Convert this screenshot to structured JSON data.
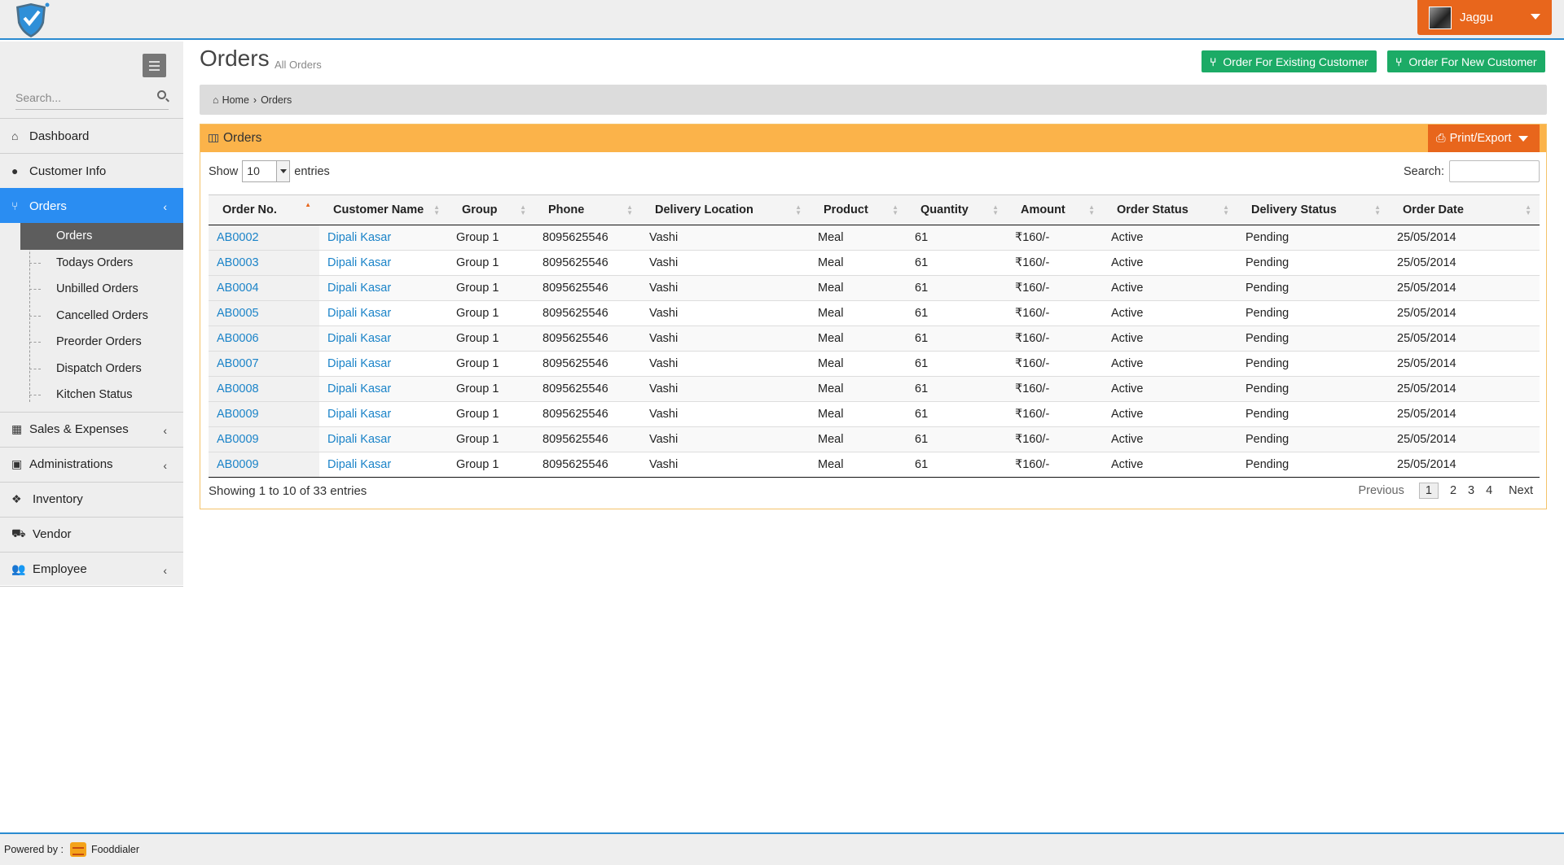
{
  "user": {
    "name": "Jaggu"
  },
  "sidebar": {
    "search_placeholder": "Search...",
    "items": [
      {
        "label": "Dashboard",
        "icon": "home-icon"
      },
      {
        "label": "Customer Info",
        "icon": "user-icon"
      },
      {
        "label": "Orders",
        "icon": "cutlery-icon",
        "active": true
      },
      {
        "label": "Sales & Expenses",
        "icon": "grid-icon"
      },
      {
        "label": "Administrations",
        "icon": "admin-icon"
      },
      {
        "label": "Inventory",
        "icon": "cubes-icon"
      },
      {
        "label": "Vendor",
        "icon": "truck-icon"
      },
      {
        "label": "Employee",
        "icon": "users-icon"
      }
    ],
    "orders_sub": [
      "Orders",
      "Todays Orders",
      "Unbilled Orders",
      "Cancelled Orders",
      "Preorder Orders",
      "Dispatch Orders",
      "Kitchen Status"
    ]
  },
  "page": {
    "title": "Orders",
    "subtitle": "All Orders",
    "btn_existing": "Order For Existing Customer",
    "btn_new": "Order For New Customer"
  },
  "breadcrumb": {
    "home": "Home",
    "current": "Orders"
  },
  "panel": {
    "title": "Orders",
    "print_label": "Print/Export",
    "show_label": "Show",
    "entries_label": "entries",
    "length_value": "10",
    "search_label": "Search:"
  },
  "table": {
    "columns": [
      "Order No.",
      "Customer Name",
      "Group",
      "Phone",
      "Delivery Location",
      "Product",
      "Quantity",
      "Amount",
      "Order Status",
      "Delivery Status",
      "Order Date"
    ],
    "rows": [
      [
        "AB0002",
        "Dipali Kasar",
        "Group 1",
        "8095625546",
        "Vashi",
        "Meal",
        "61",
        "₹160/-",
        "Active",
        "Pending",
        "25/05/2014"
      ],
      [
        "AB0003",
        "Dipali Kasar",
        "Group 1",
        "8095625546",
        "Vashi",
        "Meal",
        "61",
        "₹160/-",
        "Active",
        "Pending",
        "25/05/2014"
      ],
      [
        "AB0004",
        "Dipali Kasar",
        "Group 1",
        "8095625546",
        "Vashi",
        "Meal",
        "61",
        "₹160/-",
        "Active",
        "Pending",
        "25/05/2014"
      ],
      [
        "AB0005",
        "Dipali Kasar",
        "Group 1",
        "8095625546",
        "Vashi",
        "Meal",
        "61",
        "₹160/-",
        "Active",
        "Pending",
        "25/05/2014"
      ],
      [
        "AB0006",
        "Dipali Kasar",
        "Group 1",
        "8095625546",
        "Vashi",
        "Meal",
        "61",
        "₹160/-",
        "Active",
        "Pending",
        "25/05/2014"
      ],
      [
        "AB0007",
        "Dipali Kasar",
        "Group 1",
        "8095625546",
        "Vashi",
        "Meal",
        "61",
        "₹160/-",
        "Active",
        "Pending",
        "25/05/2014"
      ],
      [
        "AB0008",
        "Dipali Kasar",
        "Group 1",
        "8095625546",
        "Vashi",
        "Meal",
        "61",
        "₹160/-",
        "Active",
        "Pending",
        "25/05/2014"
      ],
      [
        "AB0009",
        "Dipali Kasar",
        "Group 1",
        "8095625546",
        "Vashi",
        "Meal",
        "61",
        "₹160/-",
        "Active",
        "Pending",
        "25/05/2014"
      ],
      [
        "AB0009",
        "Dipali Kasar",
        "Group 1",
        "8095625546",
        "Vashi",
        "Meal",
        "61",
        "₹160/-",
        "Active",
        "Pending",
        "25/05/2014"
      ],
      [
        "AB0009",
        "Dipali Kasar",
        "Group 1",
        "8095625546",
        "Vashi",
        "Meal",
        "61",
        "₹160/-",
        "Active",
        "Pending",
        "25/05/2014"
      ]
    ]
  },
  "pagination": {
    "info": "Showing 1 to 10 of 33 entries",
    "previous": "Previous",
    "pages": [
      "1",
      "2",
      "3",
      "4"
    ],
    "next": "Next"
  },
  "footer": {
    "powered_by": "Powered by :",
    "brand": "Fooddialer"
  },
  "colors": {
    "accent_blue": "#2a8df2",
    "orange": "#e8661c",
    "green": "#1cab66",
    "panel_yellow": "#fbb34a"
  }
}
